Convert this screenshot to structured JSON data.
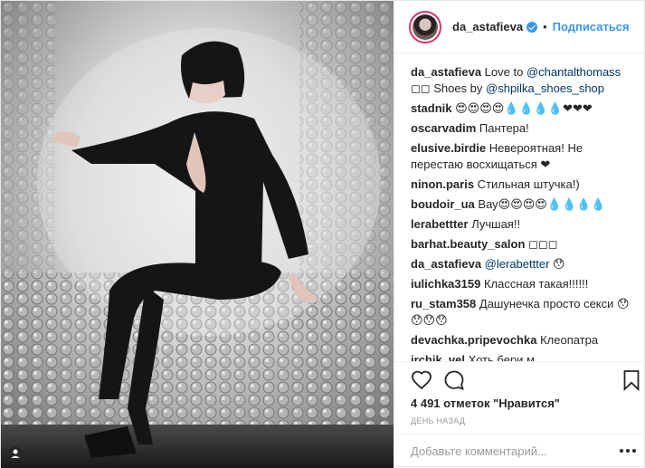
{
  "header": {
    "username": "da_astafieva",
    "separator": "•",
    "follow_label": "Подписаться"
  },
  "comments": [
    {
      "user": "da_astafieva",
      "parts": [
        {
          "t": " Love to "
        },
        {
          "m": "@chantalthomass"
        },
        {
          "t": " ◻◻ Shoes by "
        },
        {
          "m": "@shpilka_shoes_shop"
        }
      ]
    },
    {
      "user": "stadnik",
      "parts": [
        {
          "t": " 😍😍😍😍💧💧💧💧❤❤❤"
        }
      ]
    },
    {
      "user": "oscarvadim",
      "parts": [
        {
          "t": " Пантера!"
        }
      ]
    },
    {
      "user": "elusive.birdie",
      "parts": [
        {
          "t": " Невероятная! Не перестаю восхищаться ❤"
        }
      ]
    },
    {
      "user": "ninon.paris",
      "parts": [
        {
          "t": " Стильная штучка!)"
        }
      ]
    },
    {
      "user": "boudoir_ua",
      "parts": [
        {
          "t": " Вау😍😍😍😍💧💧💧💧"
        }
      ]
    },
    {
      "user": "lerabettter",
      "parts": [
        {
          "t": " Лучшая!!"
        }
      ]
    },
    {
      "user": "barhat.beauty_salon",
      "parts": [
        {
          "t": " ◻◻◻"
        }
      ]
    },
    {
      "user": "da_astafieva",
      "parts": [
        {
          "m": " @lerabettter"
        },
        {
          "t": " 😯"
        }
      ]
    },
    {
      "user": "iulichka3159",
      "parts": [
        {
          "t": " Классная такая!!!!!!"
        }
      ]
    },
    {
      "user": "ru_stam358",
      "parts": [
        {
          "t": " Дашунечка просто секси 😯😯😯😯"
        }
      ]
    },
    {
      "user": "devachka.pripevochka",
      "parts": [
        {
          "t": " Клеопатра"
        }
      ]
    },
    {
      "user": "irchik_vel",
      "parts": [
        {
          "t": " Хоть бери м"
        }
      ]
    }
  ],
  "likes_text": "4 491 отметок \"Нравится\"",
  "time_text": "ДЕНЬ НАЗАД",
  "add_comment": {
    "placeholder": "Добавьте комментарий..."
  },
  "icons": {
    "heart": "heart-icon",
    "comment": "comment-icon",
    "bookmark": "bookmark-icon",
    "more": "more-options-icon",
    "multi": "tagged-user-icon"
  },
  "colors": {
    "accent": "#3897f0",
    "text": "#262626",
    "muted": "#999999"
  }
}
